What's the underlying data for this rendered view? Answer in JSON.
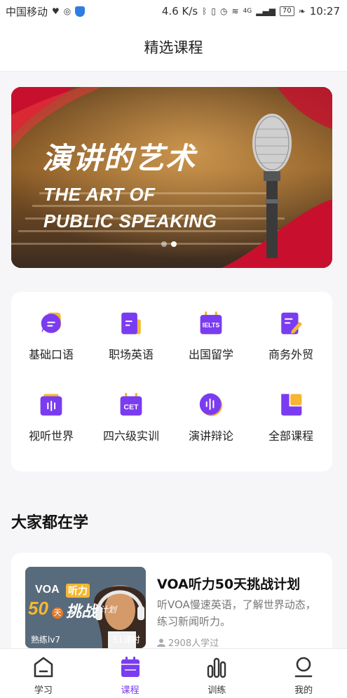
{
  "status_bar": {
    "carrier": "中国移动",
    "speed": "4.6 K/s",
    "network": "4G",
    "battery": "70",
    "time": "10:27"
  },
  "header": {
    "title": "精选课程"
  },
  "banner": {
    "title_cn": "演讲的艺术",
    "title_en_line1": "THE ART OF",
    "title_en_line2": "PUBLIC SPEAKING",
    "slide_count": 2,
    "active_slide": 2
  },
  "categories": [
    {
      "label": "基础口语",
      "icon": "speech-bubble-icon"
    },
    {
      "label": "职场英语",
      "icon": "document-icon"
    },
    {
      "label": "出国留学",
      "icon": "ielts-calendar-icon",
      "badge": "IELTS"
    },
    {
      "label": "商务外贸",
      "icon": "edit-document-icon"
    },
    {
      "label": "视听世界",
      "icon": "radio-icon"
    },
    {
      "label": "四六级实训",
      "icon": "cet-calendar-icon",
      "badge": "CET"
    },
    {
      "label": "演讲辩论",
      "icon": "audio-wave-icon"
    },
    {
      "label": "全部课程",
      "icon": "all-courses-icon"
    }
  ],
  "section": {
    "title": "大家都在学"
  },
  "course": {
    "title": "VOA听力50天挑战计划",
    "description": "听VOA慢速英语，了解世界动态，练习新闻听力。",
    "learners": "2908人学过",
    "level": "熟练lv7",
    "lessons": "51课时",
    "thumb_text_1": "VOA",
    "thumb_text_2": "听力",
    "thumb_text_3": "50",
    "thumb_text_4": "天",
    "thumb_text_5": "挑战",
    "thumb_text_6": "计划"
  },
  "tabs": [
    {
      "label": "学习",
      "icon": "home-icon"
    },
    {
      "label": "课程",
      "icon": "calendar-icon",
      "active": true
    },
    {
      "label": "训练",
      "icon": "bar-chart-icon"
    },
    {
      "label": "我的",
      "icon": "user-icon"
    }
  ],
  "colors": {
    "accent": "#7a3cf0",
    "accent_light": "#a470f5",
    "accent_yellow": "#f5b731"
  }
}
